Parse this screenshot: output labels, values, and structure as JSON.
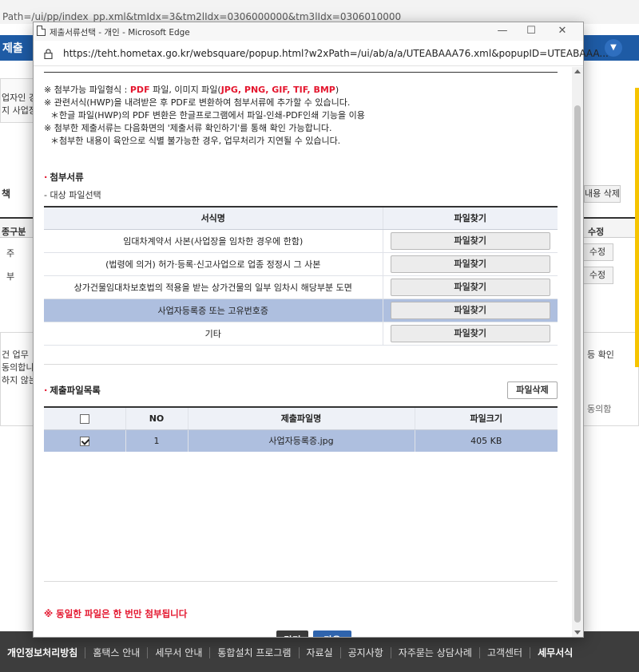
{
  "background": {
    "url_fragment": "Path=/ui/pp/index_pp.xml&tmIdx=3&tm2lIdx=0306000000&tm3lIdx=0306010000",
    "header_title": "제출",
    "left_texts": [
      "업자인 경우",
      "지 사업장"
    ],
    "section_label": "책",
    "delete_btn": "내용 삭제",
    "grid_header_left": "종구분",
    "grid_header_right": "수정",
    "grid_rows_left": [
      "주",
      "부"
    ],
    "grid_edit": "수정",
    "lower_left_texts": [
      "건 업무",
      "동의합니",
      "하지 않는"
    ],
    "confirm_text": "등 확인",
    "agree_text": "동의함"
  },
  "footer": {
    "links": [
      "개인정보처리방침",
      "홈택스 안내",
      "세무서 안내",
      "통합설치 프로그램",
      "자료실",
      "공지사항",
      "자주묻는 상담사례",
      "고객센터",
      "세무서식"
    ]
  },
  "popup": {
    "window_title": "제출서류선택 - 개인 - Microsoft Edge",
    "url": "https://teht.hometax.go.kr/websquare/popup.html?w2xPath=/ui/ab/a/a/UTEABAAA76.xml&popupID=UTEABAAA...",
    "notices": {
      "line1_prefix": "※ 첨부가능 파일형식 : ",
      "line1_pdf": "PDF",
      "line1_mid": " 파일, 이미지 파일(",
      "line1_img": "JPG, PNG, GIF, TIF, BMP",
      "line1_suffix": ")",
      "line2": "※ 관련서식(HWP)을 내려받은 후 PDF로 변환하여 첨부서류에 추가할 수 있습니다.",
      "line3": "＊한글 파일(HWP)의 PDF 변환은 한글프로그램에서 파일-인쇄-PDF인쇄 기능을 이용",
      "line4": "※ 첨부한 제출서류는 다음화면의 '제출서류 확인하기'를 통해 확인 가능합니다.",
      "line5": "＊첨부한 내용이 육안으로 식별 불가능한 경우, 업무처리가 지연될 수 있습니다."
    },
    "attach_section": {
      "title": "첨부서류",
      "subtitle": "- 대상 파일선택",
      "columns": [
        "서식명",
        "파일찾기"
      ],
      "find_label": "파일찾기",
      "rows": [
        "임대차계약서 사본(사업장을 임차한 경우에 한함)",
        "(법령에 의거) 허가·등록·신고사업으로 업종 정정시 그 사본",
        "상가건물임대차보호법의 적용을 받는 상가건물의 일부 임차시 해당부분 도면",
        "사업자등록증 또는 고유번호증",
        "기타"
      ]
    },
    "file_list": {
      "title": "제출파일목록",
      "delete_label": "파일삭제",
      "columns": [
        "NO",
        "제출파일명",
        "파일크기"
      ],
      "rows": [
        {
          "no": "1",
          "name": "사업자등록증.jpg",
          "size": "405 KB",
          "checked": true
        }
      ]
    },
    "warning": "※ 동일한 파일은 한 번만 첨부됩니다",
    "buttons": {
      "close": "닫기",
      "next": "다음"
    }
  }
}
